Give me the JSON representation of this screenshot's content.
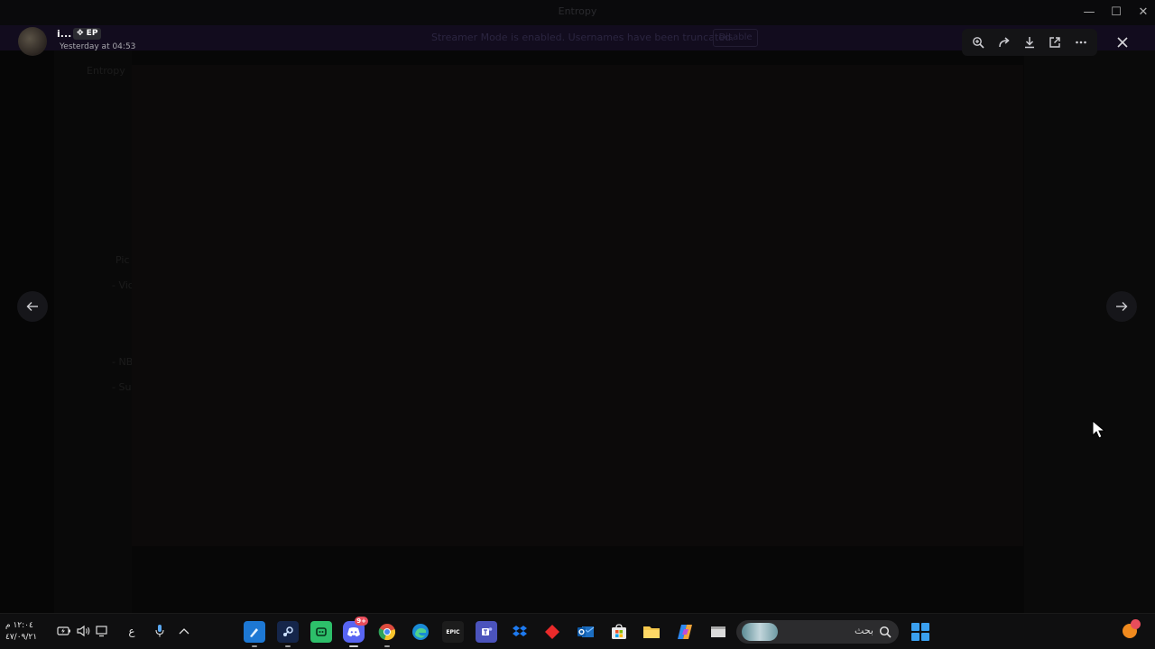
{
  "window": {
    "title": "Entropy",
    "controls": {
      "minimize": "—",
      "maximize": "☐",
      "close": "✕"
    }
  },
  "streamer_mode": {
    "message": "Streamer Mode is enabled. Usernames have been truncated.",
    "button_label": "Disable"
  },
  "background": {
    "server_name": "Entropy",
    "channels": [
      "Pic",
      "- Vid",
      "- NB",
      "- Sup"
    ]
  },
  "viewer": {
    "author": {
      "name": "i...",
      "tag": "✥ EP"
    },
    "timestamp": "Yesterday at 04:53",
    "toolbar": [
      "zoom-in-icon",
      "forward-icon",
      "download-icon",
      "open-external-icon",
      "more-icon"
    ],
    "close_icon": "close-icon",
    "prev_icon": "arrow-left-icon",
    "next_icon": "arrow-right-icon"
  },
  "taskbar": {
    "clock": {
      "time": "١٢:٠٤ م",
      "date": "٤٧/٠٩/٢١"
    },
    "input_language": "ع",
    "search_placeholder": "بحث",
    "discord_badge": "9+",
    "apps": [
      "paint",
      "steam",
      "app-green",
      "discord",
      "chrome",
      "edge",
      "epic-games",
      "teams",
      "dropbox",
      "red-app",
      "outlook",
      "store",
      "file-explorer",
      "copilot",
      "window"
    ],
    "epic_label": "EPIC",
    "colors": {
      "accent": "#3aa0f0",
      "discord": "#5865f2",
      "notification": "#e84d5b"
    }
  }
}
